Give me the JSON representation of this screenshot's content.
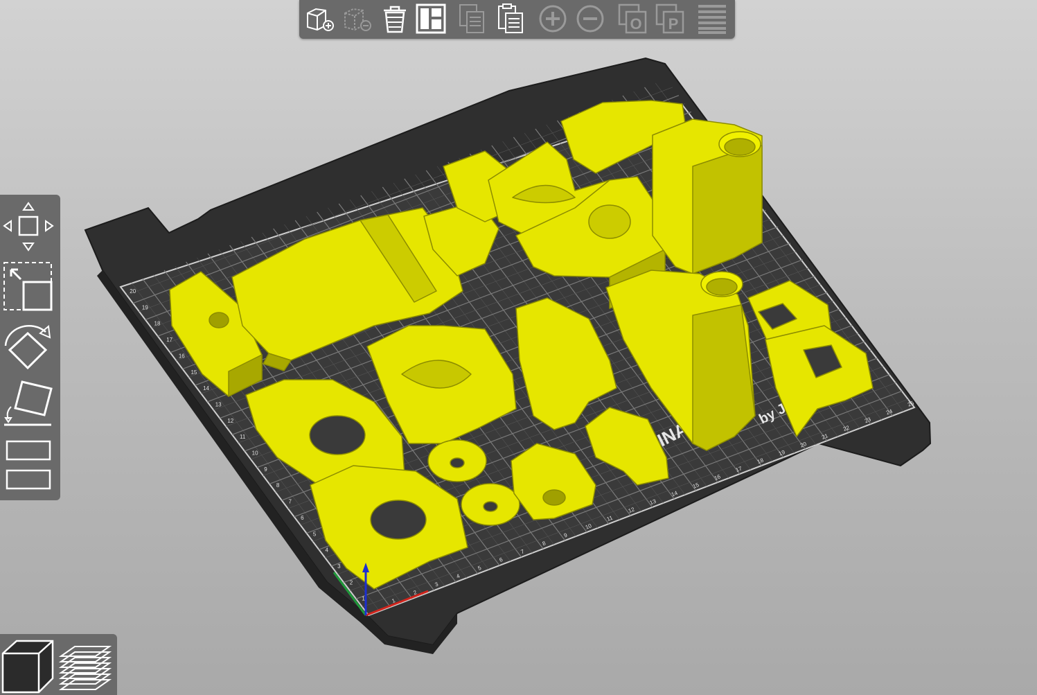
{
  "colors": {
    "background_top": "#d2d2d2",
    "background_bottom": "#a9a9a9",
    "panel": "#6a6a6a",
    "icon_active": "#ffffff",
    "icon_disabled": "#9a9a9a",
    "bed": "#2f2f2f",
    "bed_print_area": "#3a3a3a",
    "model_yellow": "#e6e600",
    "model_shadow": "#9c9c00",
    "axis_x": "#d0241c",
    "axis_y": "#1f9a3a",
    "axis_z": "#1c2fd0"
  },
  "toolbar": {
    "buttons": [
      {
        "icon": "add-object-icon",
        "enabled": true
      },
      {
        "icon": "remove-object-icon",
        "enabled": false
      },
      {
        "icon": "delete-all-icon",
        "enabled": true
      },
      {
        "icon": "arrange-icon",
        "enabled": true
      },
      {
        "icon": "copy-icon",
        "enabled": false
      },
      {
        "icon": "paste-icon",
        "enabled": true
      },
      {
        "icon": "add-instance-icon",
        "enabled": false
      },
      {
        "icon": "remove-instance-icon",
        "enabled": false
      },
      {
        "icon": "split-to-objects-icon",
        "enabled": false
      },
      {
        "icon": "split-to-parts-icon",
        "enabled": false
      },
      {
        "icon": "layers-editing-icon",
        "enabled": false
      }
    ],
    "split_objects_letter": "O",
    "split_parts_letter": "P"
  },
  "gizmos": {
    "tools": [
      {
        "icon": "move-icon"
      },
      {
        "icon": "scale-icon"
      },
      {
        "icon": "rotate-icon"
      },
      {
        "icon": "place-on-face-icon"
      },
      {
        "icon": "cut-icon"
      }
    ]
  },
  "view": {
    "buttons": [
      {
        "icon": "3d-view-icon",
        "active": true
      },
      {
        "icon": "preview-icon",
        "active": false
      }
    ]
  },
  "bed": {
    "label_fragment": "INA",
    "signature_fragment": "by J   r P",
    "x_ticks": [
      "1",
      "2",
      "3",
      "4",
      "5",
      "6",
      "7",
      "8",
      "9",
      "10",
      "11",
      "12",
      "13",
      "14",
      "15",
      "16",
      "17",
      "18",
      "19",
      "20",
      "21",
      "22",
      "23",
      "24",
      "25"
    ],
    "y_ticks": [
      "1",
      "2",
      "3",
      "4",
      "5",
      "6",
      "7",
      "8",
      "9",
      "10",
      "11",
      "12",
      "13",
      "14",
      "15",
      "16",
      "17",
      "18",
      "19",
      "20"
    ]
  }
}
